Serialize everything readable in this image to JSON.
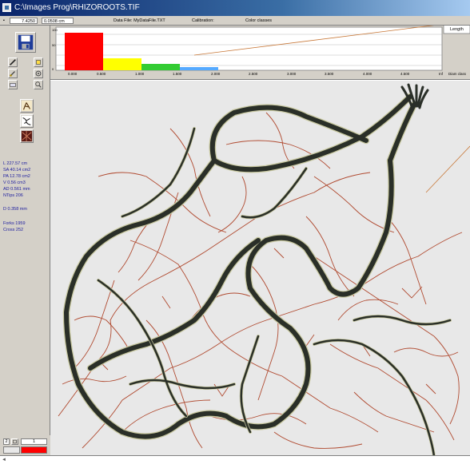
{
  "window": {
    "title": "C:\\Images Prog\\RHIZOROOTS.TIF"
  },
  "status_bar": {
    "field1": "7.4250",
    "field2": "0.0508 cm",
    "data_file": "Data File: MyDataFile.TXT",
    "calibration": "Calibration:",
    "color_classes": "Color classes"
  },
  "histogram": {
    "tab_label": "Length",
    "y_ticks": [
      "100",
      "50",
      "0"
    ],
    "x_ticks": [
      "0.000",
      "0.500",
      "1.000",
      "1.500",
      "2.000",
      "2.500",
      "3.000",
      "3.500",
      "4.000",
      "4.500"
    ],
    "x_end": "Inf",
    "diam_label": "Diam class",
    "colors": [
      "#ff0000",
      "#ffff00",
      "#33cc33",
      "#55aaff"
    ]
  },
  "stats": {
    "L": "L    227.57 cm",
    "SA": "SA  40.14 cm2",
    "PA": "PA   12.78 cm2",
    "V": "V     0.56 cm3",
    "AD": "AD  0.561 mm",
    "NTips": "NTips   206",
    "D": "D  0.358 mm",
    "Forks": "Forks  1959",
    "Cross": "Cross  252"
  },
  "bottom_panel": {
    "left_num": "2",
    "right_num": "1"
  },
  "icons": {
    "save": "floppy-disk-icon",
    "pencil": "pencil-icon",
    "eraser": "eraser-icon",
    "roots1": "root-analysis-icon",
    "roots2": "root-tips-icon",
    "roots3": "root-crossing-icon"
  },
  "colors": {
    "root_dark": "#2a2f28",
    "root_outline": "#c8c8a0",
    "root_fine": "#b04a30",
    "callout_line": "#c87838"
  }
}
